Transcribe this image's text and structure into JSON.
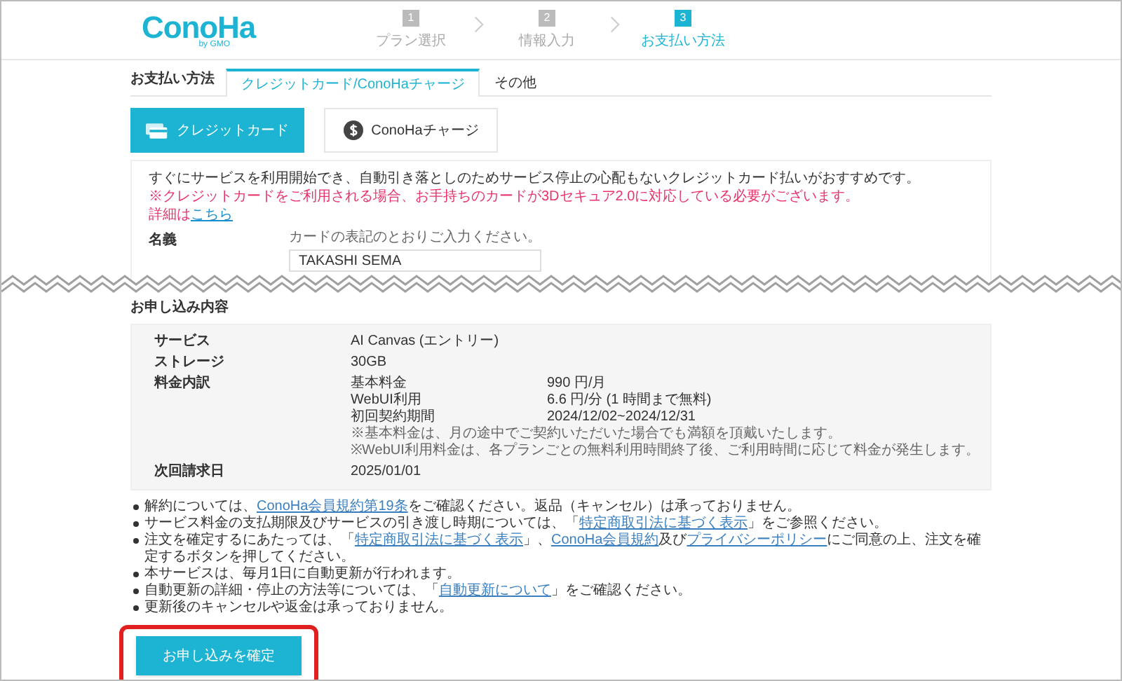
{
  "logo": {
    "text": "ConoHa",
    "sub": "by GMO"
  },
  "steps": [
    {
      "number": "1",
      "label": "プラン選択",
      "selected": false
    },
    {
      "number": "2",
      "label": "情報入力",
      "selected": false
    },
    {
      "number": "3",
      "label": "お支払い方法",
      "selected": true
    }
  ],
  "payment_tabs": {
    "label": "お支払い方法",
    "tabs": [
      {
        "label": "クレジットカード/ConoHaチャージ",
        "selected": true
      },
      {
        "label": "その他",
        "selected": false
      }
    ]
  },
  "methods": [
    {
      "label": "クレジットカード",
      "kind": "card",
      "selected": true
    },
    {
      "label": "ConoHaチャージ",
      "kind": "coin",
      "selected": false
    }
  ],
  "card_info": {
    "intro": "すぐにサービスを利用開始でき、自動引き落としのためサービス停止の心配もないクレジットカード払いがおすすめです。",
    "warning": "※クレジットカードをご利用される場合、お手持ちのカードが3Dセキュア2.0に対応している必要がございます。",
    "detail": [
      {
        "text": "詳細は",
        "link": false
      },
      {
        "text": "こちら",
        "link": true
      }
    ],
    "name_field": {
      "label": "名義",
      "hint": "カードの表記のとおりご入力ください。",
      "value": "TAKASHI SEMA"
    }
  },
  "order": {
    "title": "お申し込み内容",
    "rows": [
      {
        "label": "サービス",
        "value": "AI Canvas (エントリー)"
      },
      {
        "label": "ストレージ",
        "value": "30GB"
      },
      {
        "label": "料金内訳",
        "items": [
          {
            "label": "基本料金",
            "value": "990 円/月"
          },
          {
            "label": "WebUI利用",
            "value": "6.6 円/分 (1 時間まで無料)"
          },
          {
            "label": "初回契約期間",
            "value": "2024/12/02~2024/12/31"
          }
        ],
        "notes": [
          "※基本料金は、月の途中でご契約いただいた場合でも満額を頂戴いたします。",
          "※WebUI利用料金は、各プランごとの無料利用時間終了後、ご利用時間に応じて料金が発生します。"
        ]
      },
      {
        "label": "次回請求日",
        "value": "2025/01/01"
      }
    ]
  },
  "notes": [
    [
      {
        "text": "解約については、",
        "link": false
      },
      {
        "text": "ConoHa会員規約第19条",
        "link": true
      },
      {
        "text": "をご確認ください。返品（キャンセル）は承っておりません。",
        "link": false
      }
    ],
    [
      {
        "text": "サービス料金の支払期限及びサービスの引き渡し時期については、「",
        "link": false
      },
      {
        "text": "特定商取引法に基づく表示",
        "link": true
      },
      {
        "text": "」をご参照ください。",
        "link": false
      }
    ],
    [
      {
        "text": "注文を確定するにあたっては、「",
        "link": false
      },
      {
        "text": "特定商取引法に基づく表示",
        "link": true
      },
      {
        "text": "」、",
        "link": false
      },
      {
        "text": "ConoHa会員規約",
        "link": true
      },
      {
        "text": "及び",
        "link": false
      },
      {
        "text": "プライバシーポリシー",
        "link": true
      },
      {
        "text": "にご同意の上、注文を確定するボタンを押してください。",
        "link": false
      }
    ],
    [
      {
        "text": "本サービスは、毎月1日に自動更新が行われます。",
        "link": false
      }
    ],
    [
      {
        "text": "自動更新の詳細・停止の方法等については、「",
        "link": false
      },
      {
        "text": "自動更新について",
        "link": true
      },
      {
        "text": "」をご確認ください。",
        "link": false
      }
    ],
    [
      {
        "text": "更新後のキャンセルや返金は承っておりません。",
        "link": false
      }
    ]
  ],
  "confirm_button": "お申し込みを確定"
}
